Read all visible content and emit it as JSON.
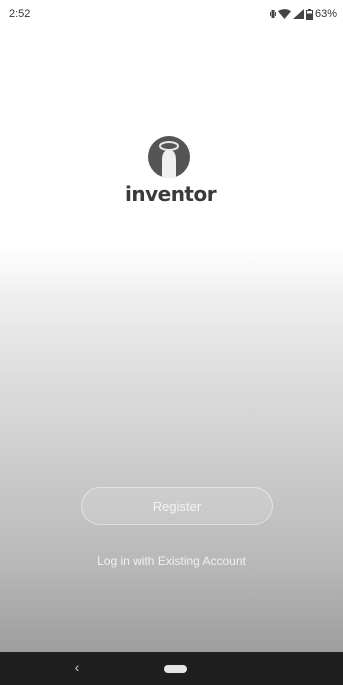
{
  "status_bar": {
    "time": "2:52",
    "battery": "63%",
    "icons": [
      "vibrate-icon",
      "wifi-icon",
      "signal-icon",
      "battery-icon"
    ]
  },
  "brand": {
    "name": "inventor"
  },
  "actions": {
    "register_label": "Register",
    "login_label": "Log in with Existing Account"
  },
  "nav": {
    "back_glyph": "‹",
    "icons": [
      "back-icon",
      "home-pill-icon"
    ]
  }
}
